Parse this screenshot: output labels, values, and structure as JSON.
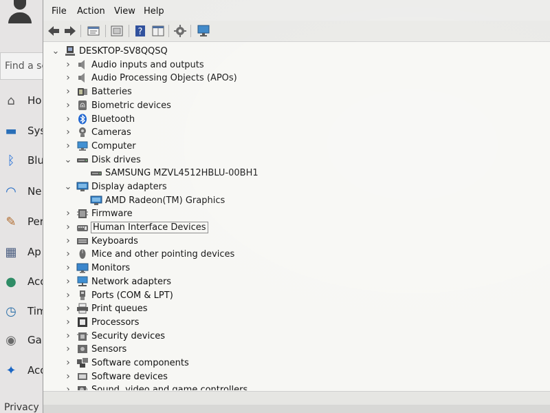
{
  "settings": {
    "search_placeholder": "Find a se",
    "nav": [
      {
        "label": "Ho",
        "icon": "home-icon",
        "color": "#5a5a5a"
      },
      {
        "label": "Sys",
        "icon": "display-icon",
        "color": "#2a6fb8"
      },
      {
        "label": "Blu",
        "icon": "bluetooth-icon",
        "color": "#1c6bd8"
      },
      {
        "label": "Ne",
        "icon": "wifi-icon",
        "color": "#1a66c4"
      },
      {
        "label": "Per",
        "icon": "brush-icon",
        "color": "#b06a2c"
      },
      {
        "label": "Ap",
        "icon": "apps-icon",
        "color": "#4a5d80"
      },
      {
        "label": "Acc",
        "icon": "person-icon",
        "color": "#2f8c66"
      },
      {
        "label": "Tim",
        "icon": "clock-icon",
        "color": "#2b6fa8"
      },
      {
        "label": "Ga",
        "icon": "gamepad-icon",
        "color": "#6a6a6a"
      },
      {
        "label": "Acc",
        "icon": "accessibility-icon",
        "color": "#1a66c4"
      }
    ],
    "bottom_label": "Privacy & security"
  },
  "menubar": [
    "File",
    "Action",
    "View",
    "Help"
  ],
  "tree": {
    "root": "DESKTOP-SV8QQSQ",
    "items": [
      {
        "label": "Audio inputs and outputs",
        "icon": "speaker-icon",
        "expanded": false
      },
      {
        "label": "Audio Processing Objects (APOs)",
        "icon": "speaker-icon",
        "expanded": false
      },
      {
        "label": "Batteries",
        "icon": "battery-icon",
        "expanded": false
      },
      {
        "label": "Biometric devices",
        "icon": "fingerprint-icon",
        "expanded": false
      },
      {
        "label": "Bluetooth",
        "icon": "bluetooth-icon",
        "expanded": false
      },
      {
        "label": "Cameras",
        "icon": "camera-icon",
        "expanded": false
      },
      {
        "label": "Computer",
        "icon": "computer-icon",
        "expanded": false
      },
      {
        "label": "Disk drives",
        "icon": "disk-icon",
        "expanded": true,
        "children": [
          "SAMSUNG MZVL4512HBLU-00BH1"
        ]
      },
      {
        "label": "Display adapters",
        "icon": "display-adapter-icon",
        "expanded": true,
        "children": [
          "AMD Radeon(TM) Graphics"
        ]
      },
      {
        "label": "Firmware",
        "icon": "firmware-icon",
        "expanded": false
      },
      {
        "label": "Human Interface Devices",
        "icon": "hid-icon",
        "expanded": false,
        "selected": true
      },
      {
        "label": "Keyboards",
        "icon": "keyboard-icon",
        "expanded": false
      },
      {
        "label": "Mice and other pointing devices",
        "icon": "mouse-icon",
        "expanded": false
      },
      {
        "label": "Monitors",
        "icon": "monitor-icon",
        "expanded": false
      },
      {
        "label": "Network adapters",
        "icon": "network-icon",
        "expanded": false
      },
      {
        "label": "Ports (COM & LPT)",
        "icon": "port-icon",
        "expanded": false
      },
      {
        "label": "Print queues",
        "icon": "printer-icon",
        "expanded": false
      },
      {
        "label": "Processors",
        "icon": "processor-icon",
        "expanded": false
      },
      {
        "label": "Security devices",
        "icon": "security-icon",
        "expanded": false
      },
      {
        "label": "Sensors",
        "icon": "sensor-icon",
        "expanded": false
      },
      {
        "label": "Software components",
        "icon": "software-component-icon",
        "expanded": false
      },
      {
        "label": "Software devices",
        "icon": "software-device-icon",
        "expanded": false
      },
      {
        "label": "Sound, video and game controllers",
        "icon": "sound-icon",
        "expanded": false
      }
    ]
  }
}
